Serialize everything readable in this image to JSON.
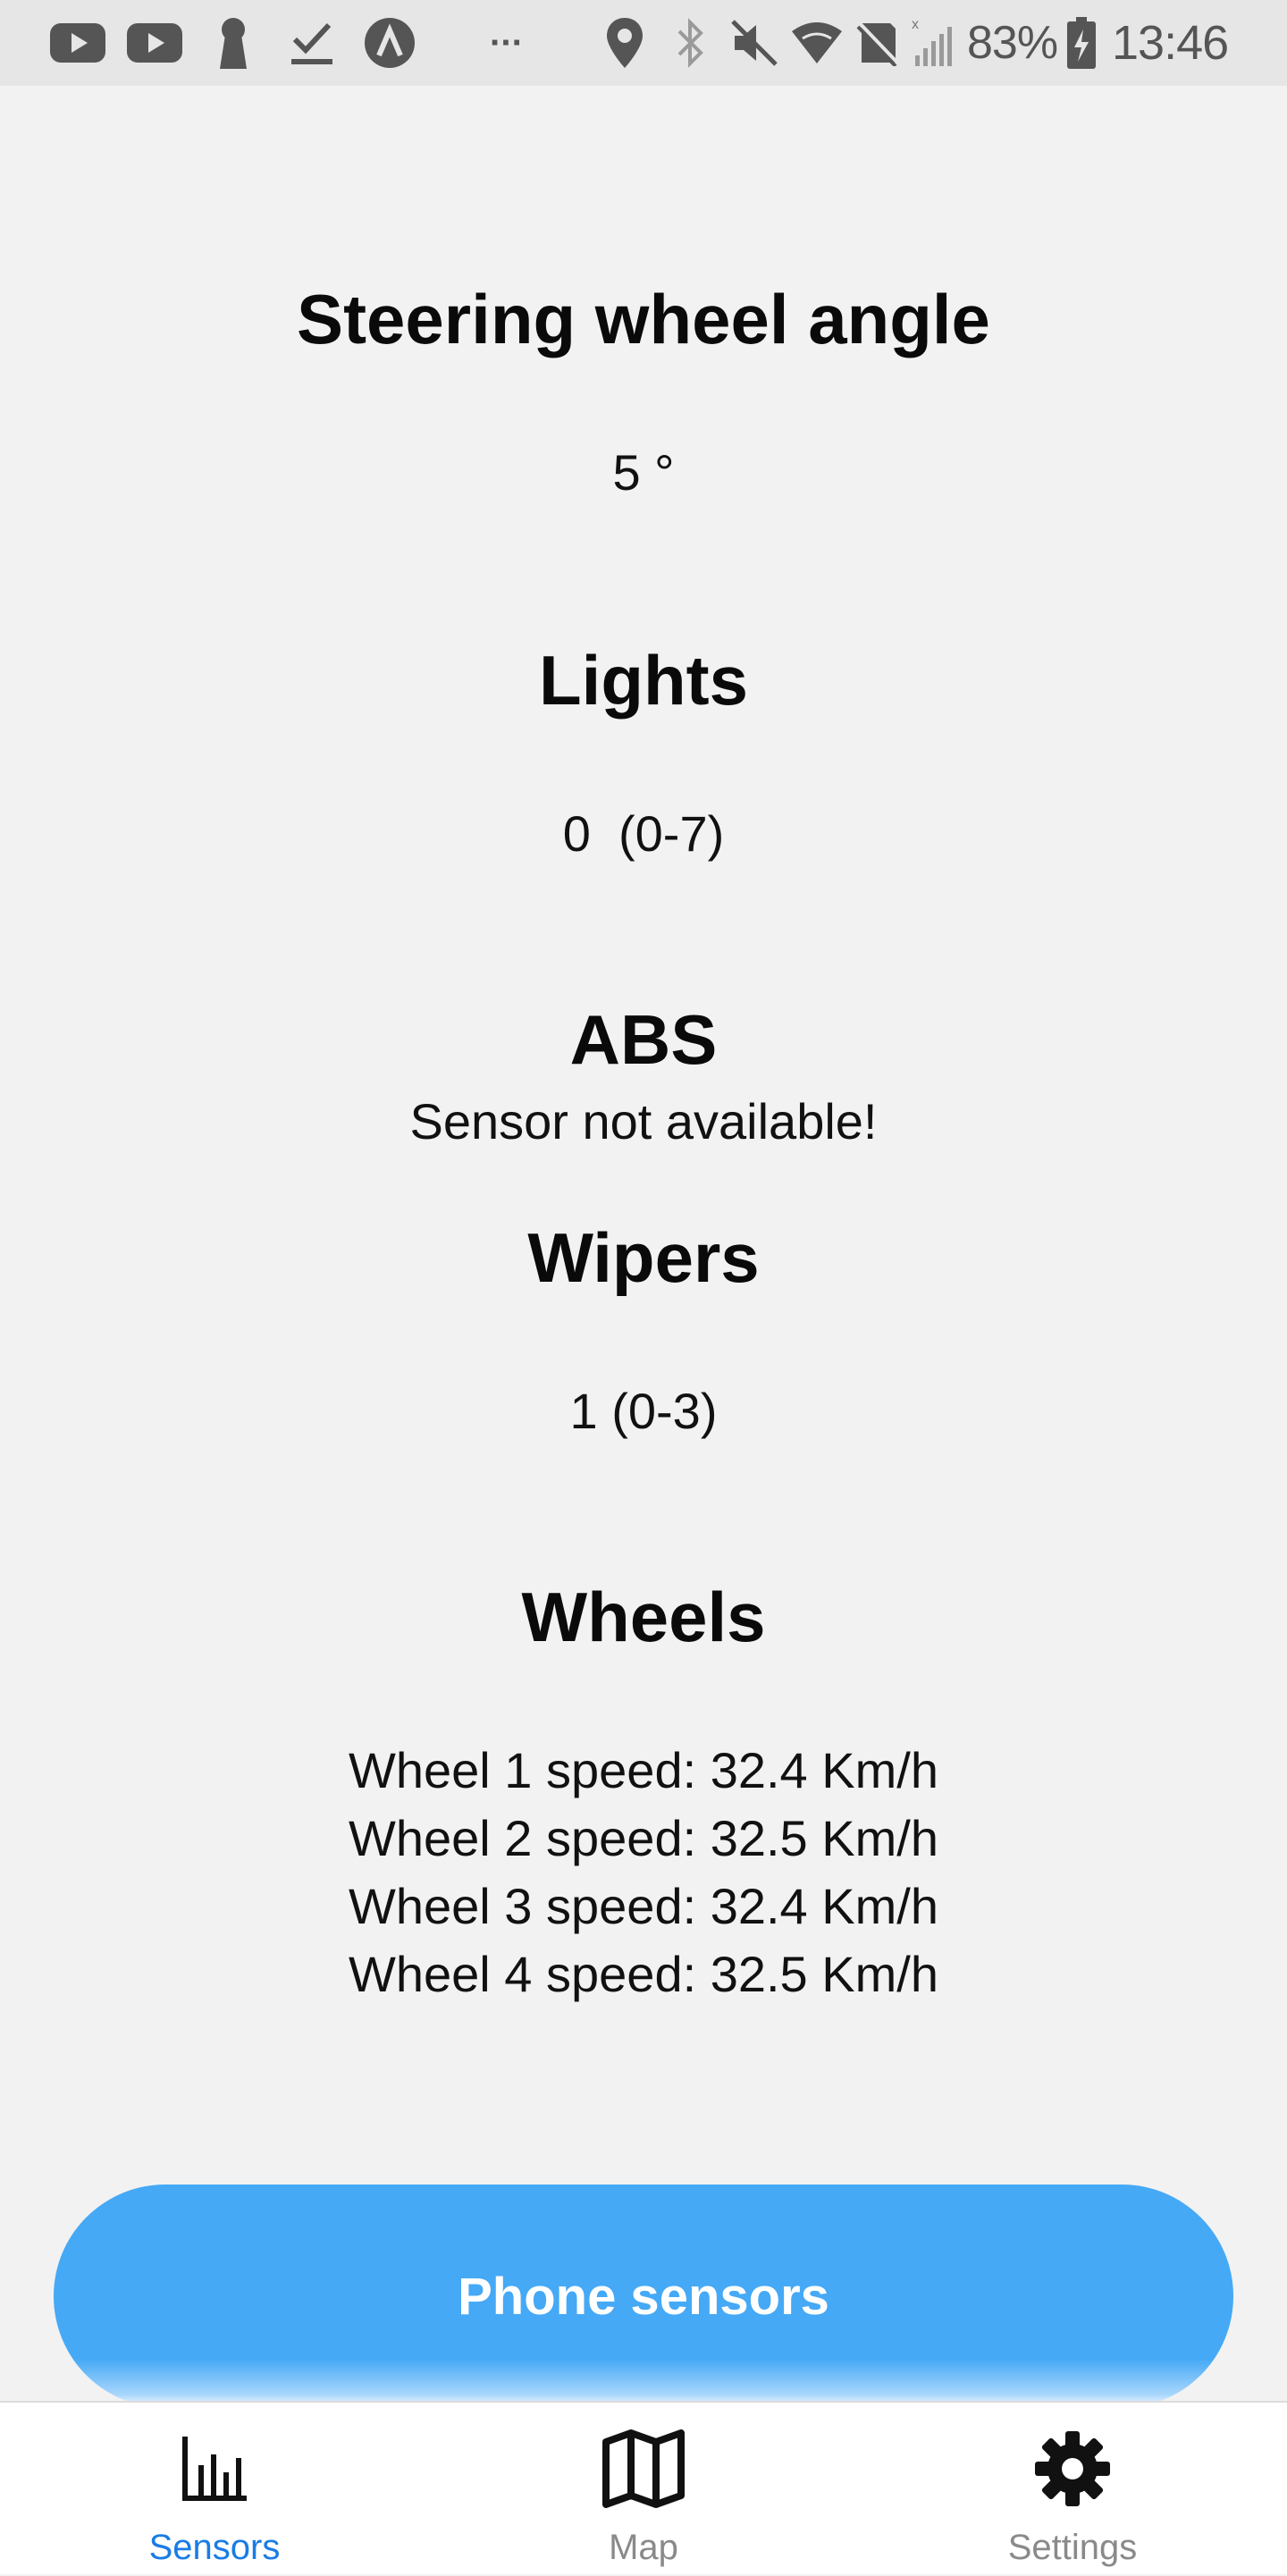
{
  "status_bar": {
    "left_icons": [
      "youtube-icon",
      "youtube-icon",
      "keyhole-icon",
      "download-done-icon",
      "app-logo-icon",
      "more-dots-icon"
    ],
    "right_icons": [
      "location-icon",
      "bluetooth-icon",
      "mute-icon",
      "wifi-icon",
      "nfc-icon",
      "signal-icon"
    ],
    "more_indicator": "···",
    "battery_percent": "83%",
    "time": "13:46"
  },
  "sensors": {
    "steering": {
      "title": "Steering wheel angle",
      "value": "5 °"
    },
    "lights": {
      "title": "Lights",
      "value": "0  (0-7)"
    },
    "abs": {
      "title": "ABS",
      "value": "Sensor not available!"
    },
    "wipers": {
      "title": "Wipers",
      "value": "1 (0-3)"
    },
    "wheels": {
      "title": "Wheels",
      "lines": [
        "Wheel 1 speed: 32.4 Km/h",
        "Wheel 2 speed: 32.5 Km/h",
        "Wheel 3 speed: 32.4 Km/h",
        "Wheel 4 speed: 32.5 Km/h"
      ]
    }
  },
  "phone_sensors_button": {
    "label": "Phone sensors"
  },
  "bottom_nav": {
    "items": [
      {
        "label": "Sensors",
        "icon": "bar-chart-icon",
        "active": true
      },
      {
        "label": "Map",
        "icon": "map-icon",
        "active": false
      },
      {
        "label": "Settings",
        "icon": "gear-icon",
        "active": false
      }
    ]
  },
  "colors": {
    "accent": "#1a7ce6",
    "button": "#45a9f6",
    "background": "#f2f2f2",
    "status_bar": "#e6e6e6"
  }
}
